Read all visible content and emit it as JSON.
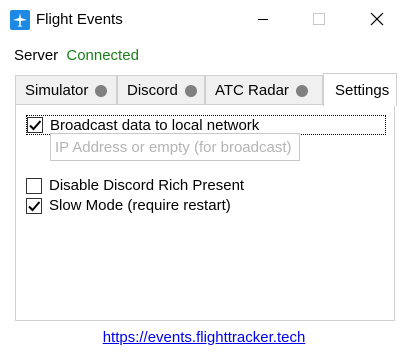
{
  "window": {
    "title": "Flight Events",
    "icon": "airplane-icon",
    "controls": [
      "minimize-icon",
      "maximize-icon",
      "close-icon"
    ]
  },
  "server": {
    "label": "Server",
    "status": "Connected",
    "status_color": "#1a7f1a"
  },
  "tabs": [
    {
      "label": "Simulator",
      "indicator_color": "#808080"
    },
    {
      "label": "Discord",
      "indicator_color": "#808080"
    },
    {
      "label": "ATC Radar",
      "indicator_color": "#808080"
    },
    {
      "label": "Settings",
      "selected": true
    }
  ],
  "settings": {
    "broadcast": {
      "label": "Broadcast data to local network",
      "checked": true
    },
    "ip_input": {
      "value": "",
      "placeholder": "IP Address or empty (for broadcast)"
    },
    "discord_rich_presence": {
      "label": "Disable Discord Rich Present",
      "checked": false
    },
    "slow_mode": {
      "label": "Slow Mode (require restart)",
      "checked": true
    }
  },
  "footer": {
    "link_text": "https://events.flighttracker.tech"
  }
}
